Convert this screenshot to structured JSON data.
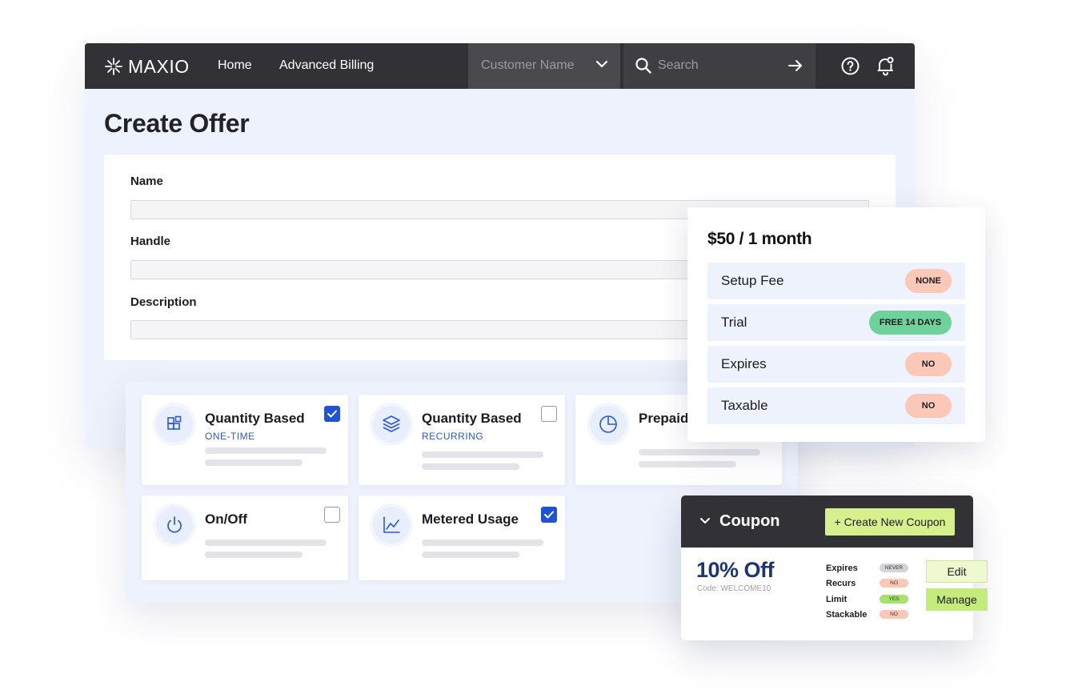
{
  "app": {
    "logo_text": "MAXIO",
    "nav": {
      "home": "Home",
      "advanced_billing": "Advanced Billing"
    },
    "customer_select": {
      "placeholder": "Customer Name"
    },
    "search": {
      "placeholder": "Search"
    },
    "icons": [
      "maxio-logo-icon",
      "chevron-down-icon",
      "search-icon",
      "arrow-right-icon",
      "help-icon",
      "bell-icon"
    ]
  },
  "page": {
    "title": "Create Offer"
  },
  "form": {
    "fields": [
      {
        "label": "Name",
        "value": ""
      },
      {
        "label": "Handle",
        "value": ""
      },
      {
        "label": "Description",
        "value": ""
      }
    ]
  },
  "product_types": [
    {
      "title": "Quantity Based",
      "subtitle": "ONE-TIME",
      "checked": true,
      "icon": "blocks-icon"
    },
    {
      "title": "Quantity Based",
      "subtitle": "RECURRING",
      "checked": false,
      "icon": "layers-icon"
    },
    {
      "title": "Prepaid",
      "subtitle": "",
      "checked": false,
      "icon": "pie-chart-icon"
    },
    {
      "title": "On/Off",
      "subtitle": "",
      "checked": false,
      "icon": "power-icon"
    },
    {
      "title": "Metered Usage",
      "subtitle": "",
      "checked": true,
      "icon": "line-chart-icon"
    }
  ],
  "price": {
    "title": "$50 / 1 month",
    "rows": [
      {
        "label": "Setup Fee",
        "badge": "NONE",
        "color": "#fbc8b8"
      },
      {
        "label": "Trial",
        "badge": "FREE 14 DAYS",
        "color": "#6fd29a"
      },
      {
        "label": "Expires",
        "badge": "NO",
        "color": "#fbc8b8"
      },
      {
        "label": "Taxable",
        "badge": "NO",
        "color": "#fbc8b8"
      }
    ]
  },
  "coupon": {
    "title": "Coupon",
    "create_button": "+ Create New Coupon",
    "discount": "10% Off",
    "code": "Code: WELCOME10",
    "attributes": [
      {
        "label": "Expires",
        "badge": "NEVER",
        "color": "#d4d4d8"
      },
      {
        "label": "Recurs",
        "badge": "NO",
        "color": "#fbc8b8"
      },
      {
        "label": "Limit",
        "badge": "YES",
        "color": "#a6e36a"
      },
      {
        "label": "Stackable",
        "badge": "NO",
        "color": "#fbc8b8"
      }
    ],
    "edit_button": "Edit",
    "manage_button": "Manage"
  },
  "colors": {
    "topbar": "#323236",
    "accent_blue": "#1f52d9",
    "lime": "#d7f08d",
    "page_bg": "#eef2fc"
  }
}
